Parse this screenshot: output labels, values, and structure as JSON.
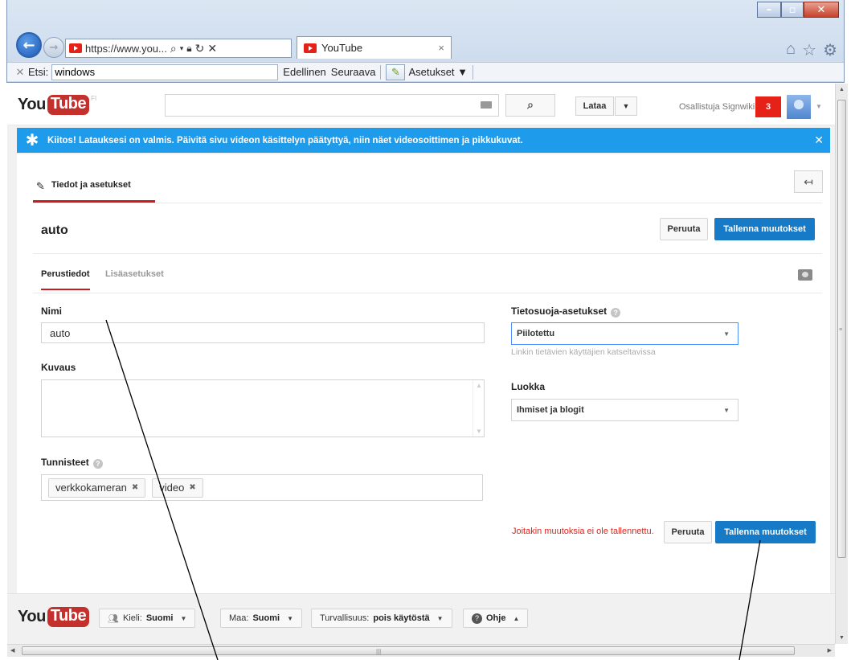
{
  "browser": {
    "address_url": "https://www.you...",
    "tab_title": "YouTube",
    "tab_close": "×",
    "back_glyph": "←",
    "forward_glyph": "→",
    "window_buttons": {
      "minimize": "–",
      "maximize": "▫",
      "close": "✕"
    },
    "find_bar": {
      "label": "Etsi:",
      "value": "windows",
      "previous": "Edellinen",
      "next": "Seuraava",
      "options": "Asetukset ▼"
    }
  },
  "masthead": {
    "logo_you": "You",
    "logo_tube": "Tube",
    "logo_region": "FI",
    "search_placeholder": "",
    "upload_label": "Lataa",
    "user_name": "Osallistuja Signwiki",
    "notification_count": "3"
  },
  "banner": {
    "message": "Kiitos! Latauksesi on valmis. Päivitä sivu videon käsittelyn päätyttyä, niin näet videosoittimen ja pikkukuvat."
  },
  "editor": {
    "tab_label": "Tiedot ja asetukset",
    "video_title": "auto",
    "cancel_label": "Peruuta",
    "save_label": "Tallenna muutokset",
    "subtabs": {
      "basic": "Perustiedot",
      "advanced": "Lisäasetukset"
    },
    "fields": {
      "name_label": "Nimi",
      "name_value": "auto",
      "description_label": "Kuvaus",
      "description_value": "",
      "tags_label": "Tunnisteet",
      "tags": [
        "verkkokameran",
        "video"
      ],
      "privacy_label": "Tietosuoja-asetukset",
      "privacy_value": "Piilotettu",
      "privacy_note": "Linkin tietävien käyttäjien katseltavissa",
      "category_label": "Luokka",
      "category_value": "Ihmiset ja blogit"
    },
    "unsaved_message": "Joitakin muutoksia ei ole tallennettu."
  },
  "footer": {
    "language_label": "Kieli:",
    "language_value": "Suomi",
    "country_label": "Maa:",
    "country_value": "Suomi",
    "safety_label": "Turvallisuus:",
    "safety_value": "pois käytöstä",
    "help_label": "Ohje"
  },
  "colors": {
    "brand_red": "#e62117",
    "primary_blue": "#167ac6",
    "banner_blue": "#1e9bea"
  }
}
